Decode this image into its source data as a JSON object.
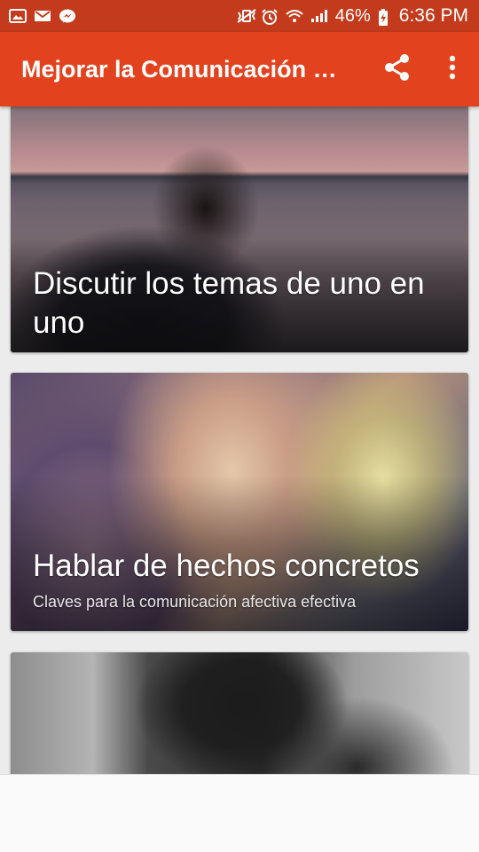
{
  "status_bar": {
    "battery_percent": "46%",
    "time": "6:36 PM",
    "left_icons": [
      "image-icon",
      "mail-icon",
      "messenger-icon"
    ],
    "right_icons": [
      "vibrate-icon",
      "alarm-icon",
      "wifi-icon",
      "signal-icon",
      "battery-charging-icon"
    ]
  },
  "app_bar": {
    "title": "Mejorar la Comunicación en Pareja",
    "actions": [
      "share-icon",
      "more-vert-icon"
    ]
  },
  "colors": {
    "status_bar": "#c33a1c",
    "app_bar": "#e2431e",
    "background": "#ececec"
  },
  "cards": [
    {
      "title": "Discutir los temas de uno en uno",
      "subtitle": ""
    },
    {
      "title": "Hablar de hechos concretos",
      "subtitle": "Claves para la comunicación afectiva efectiva"
    },
    {
      "title": "",
      "subtitle": ""
    }
  ]
}
